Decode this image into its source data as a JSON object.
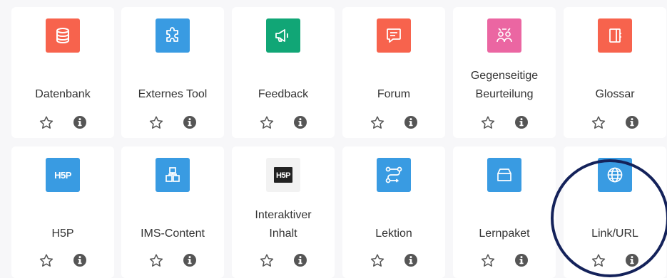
{
  "activities": [
    {
      "label": "Datenbank",
      "icon": "database-icon",
      "color": "#f7634d"
    },
    {
      "label": "Externes Tool",
      "icon": "puzzle-icon",
      "color": "#399be2"
    },
    {
      "label": "Feedback",
      "icon": "megaphone-icon",
      "color": "#11a676"
    },
    {
      "label": "Forum",
      "icon": "chat-icon",
      "color": "#f7634d"
    },
    {
      "label": "Gegenseitige Beurteilung",
      "icon": "people-review-icon",
      "color": "#eb66a2"
    },
    {
      "label": "Glossar",
      "icon": "book-icon",
      "color": "#f7634d"
    },
    {
      "label": "H5P",
      "icon": "h5p-icon",
      "color": "#399be2"
    },
    {
      "label": "IMS-Content",
      "icon": "package-blocks-icon",
      "color": "#399be2"
    },
    {
      "label": "Interaktiver Inhalt",
      "icon": "h5p-icon",
      "color": "#f2f2f2"
    },
    {
      "label": "Lektion",
      "icon": "route-icon",
      "color": "#399be2"
    },
    {
      "label": "Lernpaket",
      "icon": "box-icon",
      "color": "#399be2"
    },
    {
      "label": "Link/URL",
      "icon": "globe-icon",
      "color": "#399be2"
    }
  ],
  "icon_glyphs": {
    "h5p_text": "H5P",
    "h5p_text_dark": "H5P"
  },
  "accent": {
    "highlight_ring": "#14225a",
    "star": "#555555",
    "info": "#555555"
  }
}
